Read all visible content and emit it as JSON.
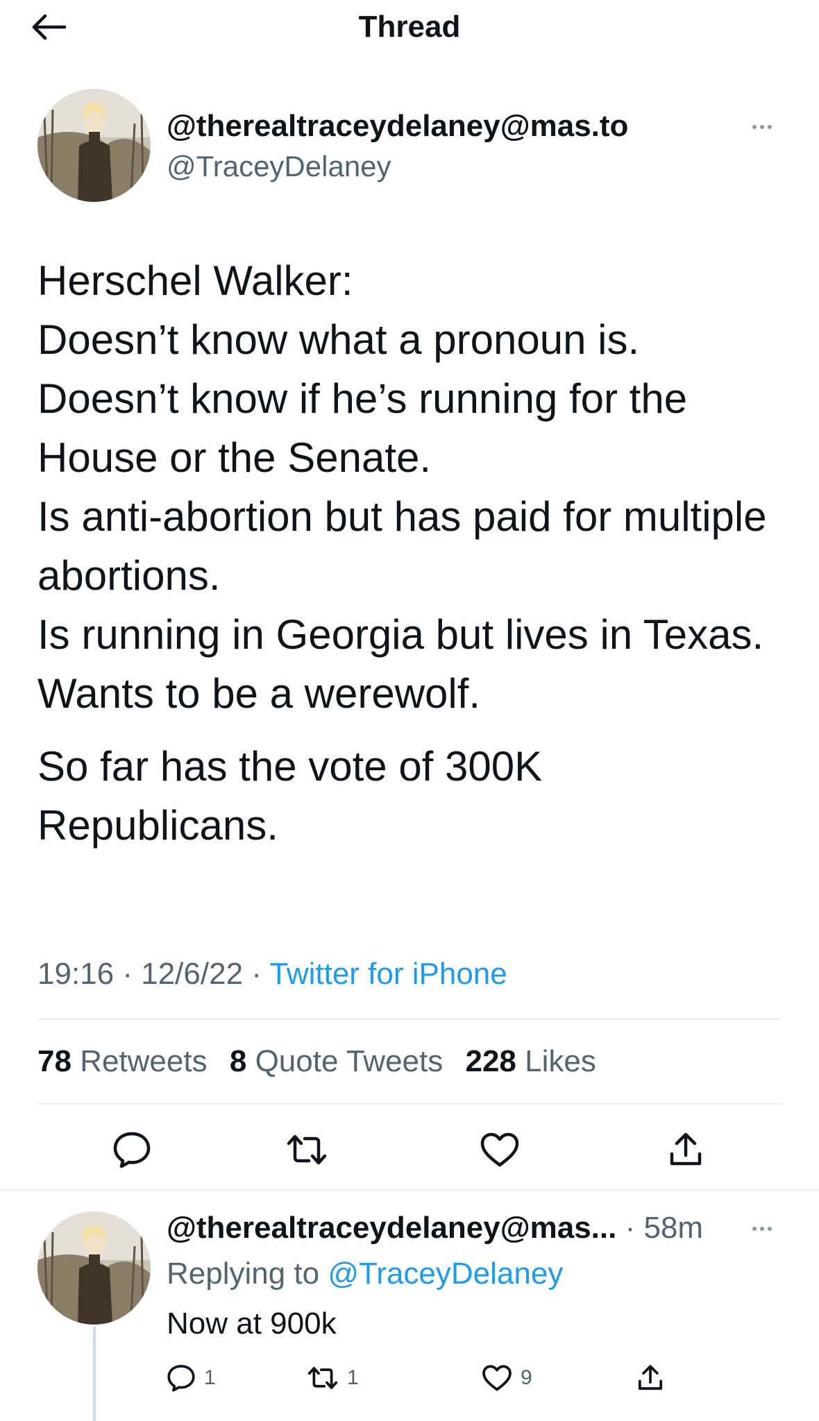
{
  "header": {
    "title": "Thread"
  },
  "main_tweet": {
    "display_name": "@therealtraceydelaney@mas.to",
    "handle": "@TraceyDelaney",
    "body_para1": "Herschel Walker:\nDoesn’t know what a pronoun is.\nDoesn’t know if he’s running for the House or the Senate.\nIs anti-abortion but has paid for multiple abortions.\nIs running in Georgia but lives in Texas.\nWants to be a werewolf.",
    "body_para2": "So far has the vote of 300K Republicans.",
    "time": "19:16",
    "date": "12/6/22",
    "separator": "·",
    "source": "Twitter for iPhone",
    "stats": {
      "retweets_count": "78",
      "retweets_label": "Retweets",
      "quotes_count": "8",
      "quotes_label": "Quote Tweets",
      "likes_count": "228",
      "likes_label": "Likes"
    }
  },
  "reply_tweet": {
    "display_name": "@therealtraceydelaney@mas...",
    "separator": "·",
    "time_ago": "58m",
    "replying_label": "Replying to",
    "replying_to": "@TraceyDelaney",
    "text": "Now at 900k",
    "reply_count": "1",
    "retweet_count": "1",
    "like_count": "9"
  },
  "icons": [
    "back-arrow-icon",
    "more-icon",
    "reply-icon",
    "retweet-icon",
    "like-icon",
    "share-icon"
  ],
  "colors": {
    "text": "#0f1419",
    "secondary": "#536471",
    "accent": "#1d9bf0",
    "divider": "#e6ecf0"
  }
}
